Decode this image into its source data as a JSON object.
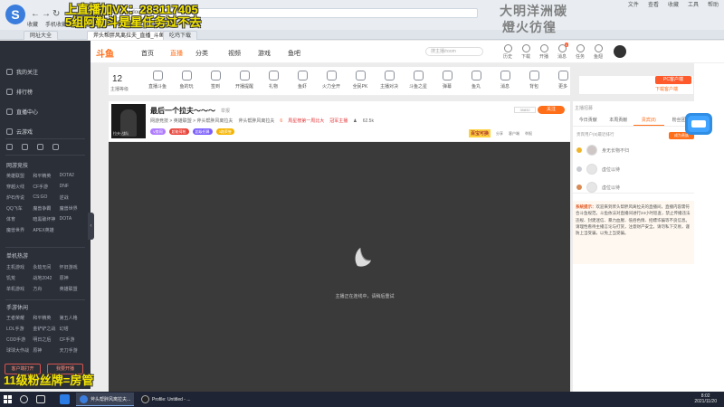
{
  "overlay": {
    "line1": "上直播加VX：283117405",
    "line2": "5组阿勒斗是星任务过不去",
    "line3": "11级粉丝牌=房管",
    "right1": "大明洋洲碳",
    "right2": "燈火彷徨"
  },
  "browser": {
    "url": "https://www.douyu.com",
    "bookmarks": [
      "收藏",
      "手机收藏夹",
      "网址大全"
    ],
    "tabs": [
      "网址大全",
      "斧头帮胖风离拉夫_直播_斗鱼",
      "吃鸡下载"
    ],
    "right_items": [
      "文件",
      "查看",
      "收藏",
      "工具",
      "帮助"
    ]
  },
  "sidebar": {
    "items": [
      "我的关注",
      "排行榜",
      "直播中心",
      "云游戏"
    ],
    "section1": "网游竞技",
    "section1_items": [
      "英雄联盟",
      "和平精英",
      "DOTA2",
      "穿越火线",
      "CF手游",
      "DNF",
      "炉石传说",
      "CS:GO",
      "逆战",
      "QQ飞车",
      "魔兽争霸",
      "魔兽世界",
      "体育",
      "暗黑破坏神",
      "DOTA",
      "魔兽世界",
      "APEX英雄"
    ],
    "section2": "单机热游",
    "section2_items": [
      "主机游戏",
      "永劫无间",
      "怀旧游戏",
      "饥荒",
      "战地2042",
      "原神",
      "单机游戏",
      "方舟",
      "英雄联盟"
    ],
    "section3": "手游休闲",
    "section3_items": [
      "王者荣耀",
      "和平精英",
      "第五人格",
      "LOL手游",
      "金铲铲之战",
      "幻塔",
      "COD手游",
      "明日之后",
      "CF手游",
      "球球大作战",
      "原神",
      "天刀手游"
    ],
    "btn_left": "客户端打开",
    "btn_right": "我要开播"
  },
  "header": {
    "logo": "斗鱼",
    "nav": [
      "首页",
      "直播",
      "分类",
      "视频",
      "游戏",
      "鱼吧"
    ],
    "active_nav": "直播",
    "search_placeholder": "搜主播/room",
    "icons": [
      "历史",
      "下载",
      "开播",
      "消息",
      "任务",
      "鱼翅"
    ],
    "badge": "1"
  },
  "category_bar": {
    "level": "12",
    "level_label": "主播等级",
    "items": [
      "直播斗鱼",
      "鱼的玩",
      "签到",
      "开播提醒",
      "礼物",
      "鱼虾",
      "火力全开",
      "全民PK",
      "主播对决",
      "斗鱼之星",
      "弹幕",
      "鱼丸",
      "消息",
      "背包",
      "更多"
    ]
  },
  "pc_client": {
    "button": "PC客户端",
    "link": "下载客户端"
  },
  "room": {
    "title": "最后一个拉夫～～～",
    "tag": "举报",
    "breadcrumb": "网游竞技 > 英雄联盟 > 斧头帮胖风离拉夫",
    "anchor": "斧头帮胖风离拉夫",
    "level": "6",
    "hot_rank": "周星榜第一周比大",
    "honor": "冠军主播",
    "fans": "62.5k",
    "badges": [
      "V房间",
      "超能荷枪",
      "超级招募",
      "3路荣誉"
    ],
    "fans_count": "35832",
    "follow": "关注",
    "gift_label": "百宝可换",
    "actions": [
      "分享",
      "客户端",
      "举报"
    ],
    "avatar_name": "拉夫·战队"
  },
  "video": {
    "message": "主播正在连线中，请稍后重试"
  },
  "right_panel": {
    "header": "主播招募",
    "tabs": [
      "今日贡献",
      "本周贡献",
      "贵宾(8)",
      "粉丝团"
    ],
    "open_noble": "成为贵族",
    "rank_title": "贵宾用户(8)最近排行",
    "ranks": [
      "身无长物不归",
      "虚位以待",
      "虚位以待"
    ],
    "notice_label": "系统提示：",
    "notice": "欢迎来到斧头帮胖风离拉夫的直播间，直播内容需符合斗鱼规范。斗鱼依法对直播间进行24小时巡查，禁止传播违法违规、封建迷信、暴力血腥、低俗色情、招嫖诈骗等不良信息。请理性看待主播言论与打赏，注意财产安全。请勿私下交易，谨防上当受骗，以免上当受骗。"
  },
  "taskbar": {
    "apps": [
      "斧头帮胖风离拉夫...",
      "Profile: Untitled - ..."
    ],
    "time": "8:02",
    "date": "2021/11/20"
  },
  "colors": {
    "accent": "#ff6f1a",
    "sidebar_bg": "#2b2f38",
    "video_bg": "#3a3a3a",
    "overlay_yellow": "#f2e400"
  }
}
